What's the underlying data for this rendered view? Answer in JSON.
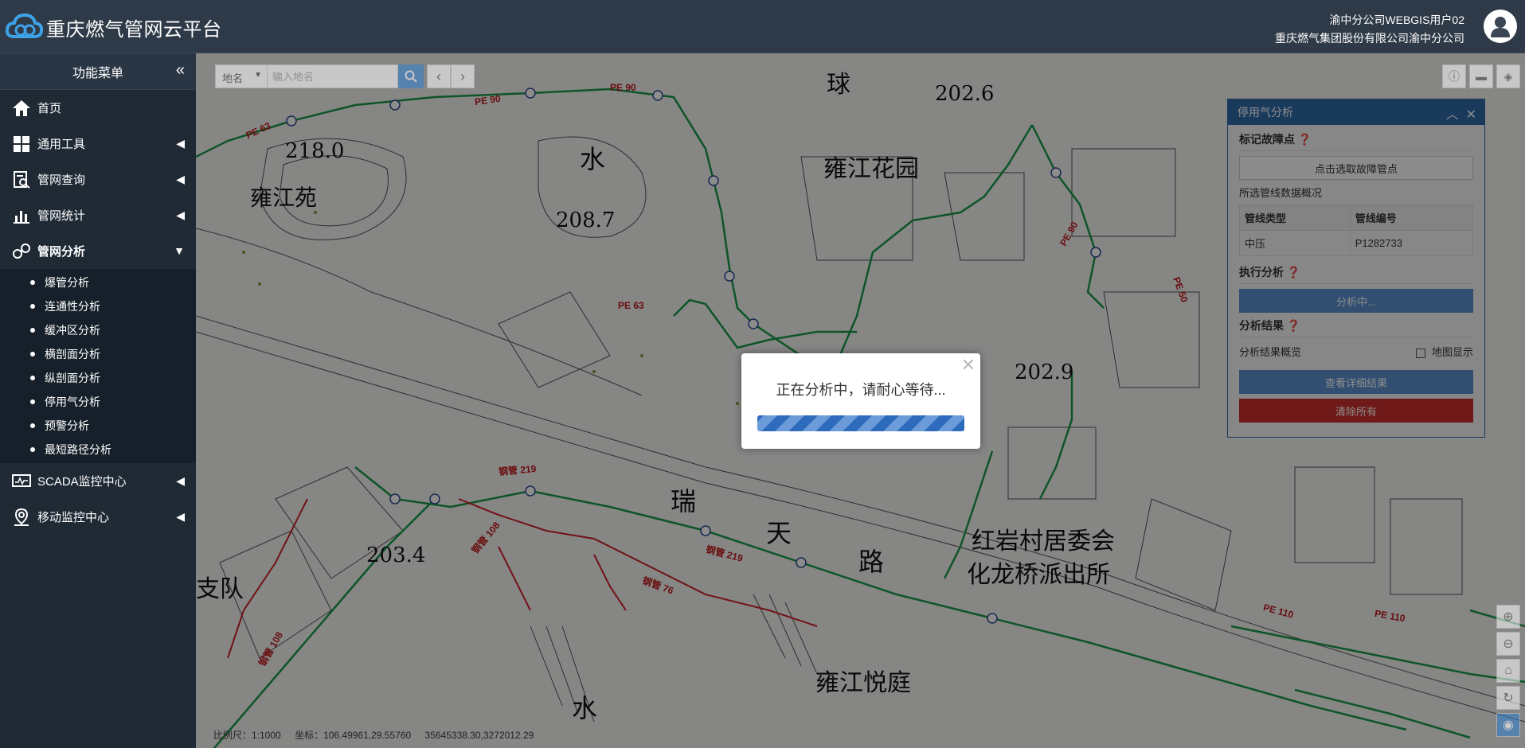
{
  "app": {
    "title": "重庆燃气管网云平台",
    "user_line1": "渝中分公司WEBGIS用户02",
    "user_line2": "重庆燃气集团股份有限公司渝中分公司"
  },
  "sidebar": {
    "header": "功能菜单",
    "items": [
      {
        "label": "首页",
        "icon": "home-icon"
      },
      {
        "label": "通用工具",
        "icon": "grid-icon"
      },
      {
        "label": "管网查询",
        "icon": "search-doc-icon"
      },
      {
        "label": "管网统计",
        "icon": "chart-icon"
      },
      {
        "label": "管网分析",
        "icon": "analysis-icon"
      },
      {
        "label": "SCADA监控中心",
        "icon": "monitor-icon"
      },
      {
        "label": "移动监控中心",
        "icon": "location-icon"
      }
    ],
    "analysis_sub": [
      "爆管分析",
      "连通性分析",
      "缓冲区分析",
      "横剖面分析",
      "纵剖面分析",
      "停用气分析",
      "预警分析",
      "最短路径分析"
    ]
  },
  "search": {
    "type_label": "地名",
    "placeholder": "输入地名"
  },
  "status": {
    "scale": "比例尺：1:1000",
    "coords": "坐标：106.49961,29.55760",
    "proj": "35645338.30,3272012.29"
  },
  "panel": {
    "title": "停用气分析",
    "mark_section": "标记故障点",
    "pick_button": "点击选取故障管点",
    "overview_label": "所选管线数据概况",
    "table_headers": [
      "管线类型",
      "管线编号"
    ],
    "table_row": [
      "中压",
      "P1282733"
    ],
    "exec_section": "执行分析",
    "analyzing_button": "分析中...",
    "result_section": "分析结果",
    "result_overview": "分析结果概览",
    "map_display": "地图显示",
    "detail_button": "查看详细结果",
    "clear_button": "清除所有"
  },
  "modal": {
    "message": "正在分析中，请耐心等待..."
  },
  "map_labels": [
    "218.0",
    "雍江苑",
    "水",
    "208.7",
    "雍江花园",
    "202.6",
    "球",
    "202.9",
    "瑞",
    "天",
    "路",
    "红岩村居委会",
    "化龙桥派出所",
    "203.4",
    "支队",
    "雍江悦庭"
  ],
  "pipe_labels": [
    "PE 63",
    "PE 90",
    "钢管 219",
    "钢管 108",
    "钢管 76",
    "PE 110",
    "PE 50"
  ],
  "colors": {
    "header_bg": "#2e3a47",
    "sidebar_bg": "#1f2a35",
    "accent_blue": "#2f7fd0",
    "panel_blue": "#2f6aa8",
    "danger_red": "#c9302c",
    "pipe_green": "#1a9a4a",
    "pipe_red": "#d0202a"
  }
}
